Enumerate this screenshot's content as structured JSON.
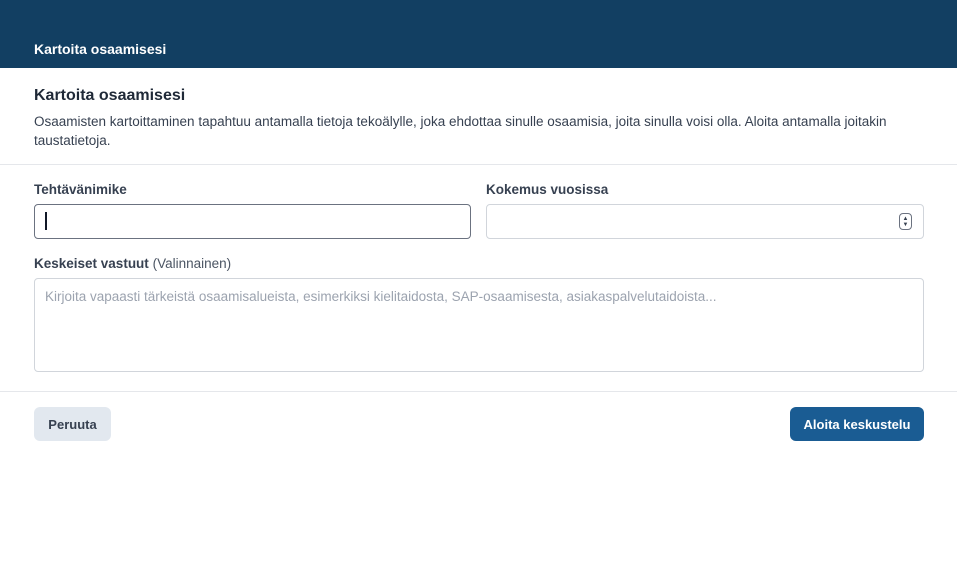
{
  "topbar": {
    "title": "Kartoita osaamisesi"
  },
  "dialog": {
    "title": "Kartoita osaamisesi",
    "description": "Osaamisten kartoittaminen tapahtuu antamalla tietoja tekoälylle, joka ehdottaa sinulle osaamisia, joita sinulla voisi olla. Aloita antamalla joitakin taustatietoja."
  },
  "form": {
    "job_title": {
      "label": "Tehtävänimike",
      "value": ""
    },
    "experience": {
      "label": "Kokemus vuosissa",
      "value": ""
    },
    "responsibilities": {
      "label": "Keskeiset vastuut",
      "optional_label": "(Valinnainen)",
      "placeholder": "Kirjoita vapaasti tärkeistä osaamisalueista, esimerkiksi kielitaidosta, SAP-osaamisesta, asiakaspalvelutaidoista..."
    }
  },
  "actions": {
    "cancel_label": "Peruuta",
    "start_label": "Aloita keskustelu"
  },
  "colors": {
    "topbar": "#123f62",
    "primary_button": "#1a5c93",
    "secondary_button": "#e2e8ef"
  }
}
